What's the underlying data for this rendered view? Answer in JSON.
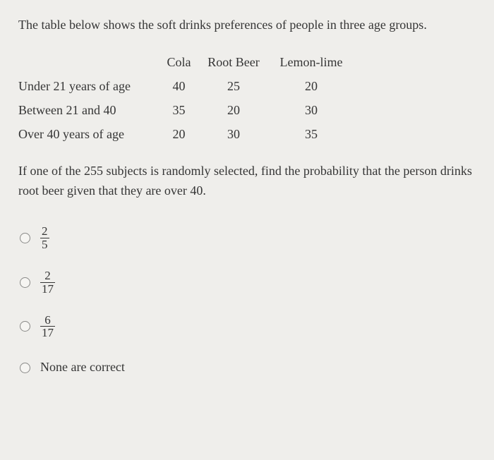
{
  "intro": "The table below shows the soft drinks preferences of people in three age groups.",
  "table": {
    "headers": {
      "c1": "Cola",
      "c2": "Root Beer",
      "c3": "Lemon-lime"
    },
    "rows": [
      {
        "label": "Under 21 years of age",
        "c1": "40",
        "c2": "25",
        "c3": "20"
      },
      {
        "label": "Between 21 and 40",
        "c1": "35",
        "c2": "20",
        "c3": "30"
      },
      {
        "label": "Over 40 years of age",
        "c1": "20",
        "c2": "30",
        "c3": "35"
      }
    ]
  },
  "question": "If one of the 255 subjects is randomly selected, find the probability that the person drinks root beer given that they are over 40.",
  "options": [
    {
      "type": "fraction",
      "num": "2",
      "den": "5"
    },
    {
      "type": "fraction",
      "num": "2",
      "den": "17"
    },
    {
      "type": "fraction",
      "num": "6",
      "den": "17"
    },
    {
      "type": "text",
      "text": "None are correct"
    }
  ]
}
